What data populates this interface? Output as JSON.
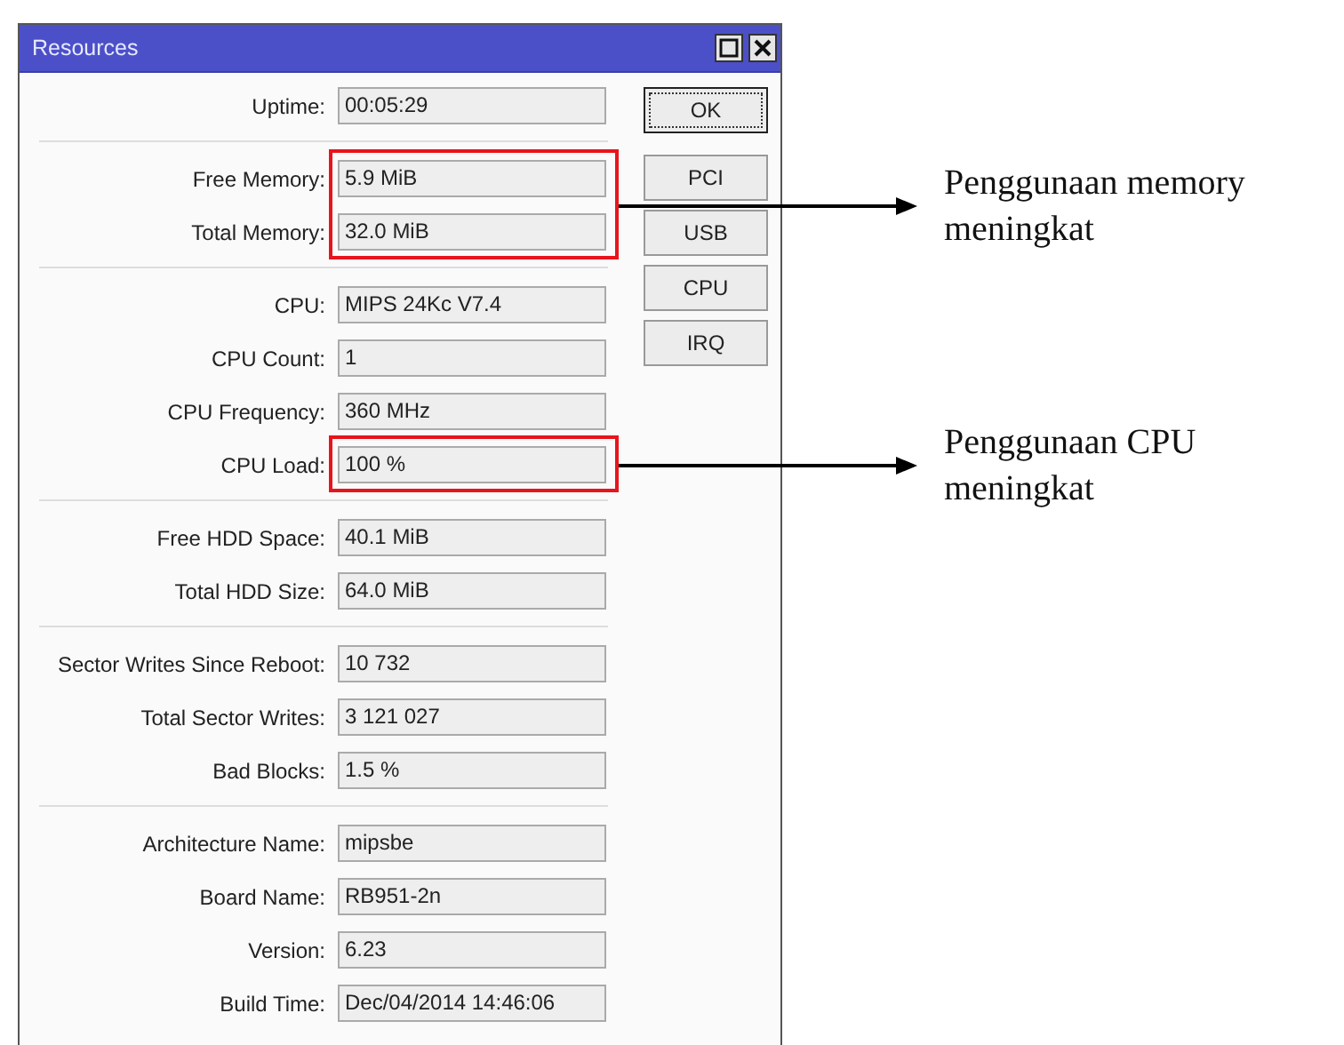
{
  "window": {
    "title": "Resources"
  },
  "groups": [
    {
      "rows": [
        {
          "label": "Uptime:",
          "value": "00:05:29",
          "highlighted": false
        }
      ]
    },
    {
      "rows": [
        {
          "label": "Free Memory:",
          "value": "5.9 MiB",
          "highlighted": true
        },
        {
          "label": "Total Memory:",
          "value": "32.0 MiB",
          "highlighted": true
        }
      ]
    },
    {
      "rows": [
        {
          "label": "CPU:",
          "value": "MIPS 24Kc V7.4",
          "highlighted": false
        },
        {
          "label": "CPU Count:",
          "value": "1",
          "highlighted": false
        },
        {
          "label": "CPU Frequency:",
          "value": "360 MHz",
          "highlighted": false
        },
        {
          "label": "CPU Load:",
          "value": "100 %",
          "highlighted": true
        }
      ]
    },
    {
      "rows": [
        {
          "label": "Free HDD Space:",
          "value": "40.1 MiB",
          "highlighted": false
        },
        {
          "label": "Total HDD Size:",
          "value": "64.0 MiB",
          "highlighted": false
        }
      ]
    },
    {
      "rows": [
        {
          "label": "Sector Writes Since Reboot:",
          "value": "10 732",
          "highlighted": false
        },
        {
          "label": "Total Sector Writes:",
          "value": "3 121 027",
          "highlighted": false
        },
        {
          "label": "Bad Blocks:",
          "value": "1.5 %",
          "highlighted": false
        }
      ]
    },
    {
      "rows": [
        {
          "label": "Architecture Name:",
          "value": "mipsbe",
          "highlighted": false
        },
        {
          "label": "Board Name:",
          "value": "RB951-2n",
          "highlighted": false
        },
        {
          "label": "Version:",
          "value": "6.23",
          "highlighted": false
        },
        {
          "label": "Build Time:",
          "value": "Dec/04/2014 14:46:06",
          "highlighted": false
        }
      ]
    }
  ],
  "buttons": [
    {
      "label": "OK",
      "focused": true
    },
    {
      "label": "PCI",
      "focused": false
    },
    {
      "label": "USB",
      "focused": false
    },
    {
      "label": "CPU",
      "focused": false
    },
    {
      "label": "IRQ",
      "focused": false
    }
  ],
  "callouts": [
    {
      "text": "Penggunaan memory meningkat"
    },
    {
      "text": "Penggunaan CPU meningkat"
    }
  ]
}
